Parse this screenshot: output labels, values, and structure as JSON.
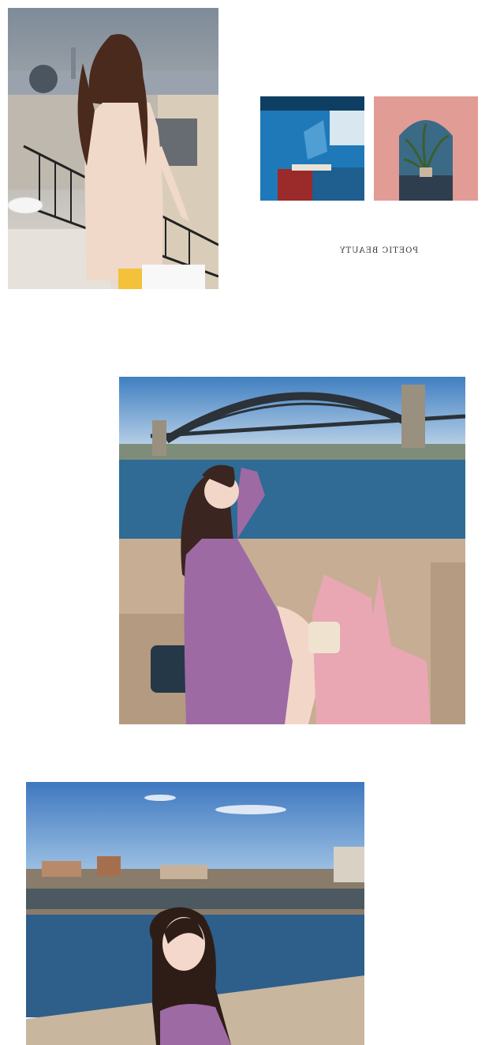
{
  "caption": {
    "text": "POETIC BEAUTY",
    "mirrored": true
  },
  "photos": [
    {
      "name": "paris-balcony-photo",
      "description_icon": "photo"
    },
    {
      "name": "blue-room-thumbnail",
      "description_icon": "photo"
    },
    {
      "name": "pink-arch-thumbnail",
      "description_icon": "photo"
    },
    {
      "name": "harbour-bridge-photo",
      "description_icon": "photo"
    },
    {
      "name": "waterfront-portrait-photo",
      "description_icon": "photo"
    }
  ],
  "colors": {
    "background": "#ffffff",
    "sky": "#9dc3e6",
    "water": "#2f6b95",
    "dress_pink": "#f0d9c9",
    "dress_purple": "#9d6aa3",
    "coat_pink": "#e8a7b2",
    "wall_blue": "#1f79b8",
    "wall_pink": "#e19c96"
  }
}
